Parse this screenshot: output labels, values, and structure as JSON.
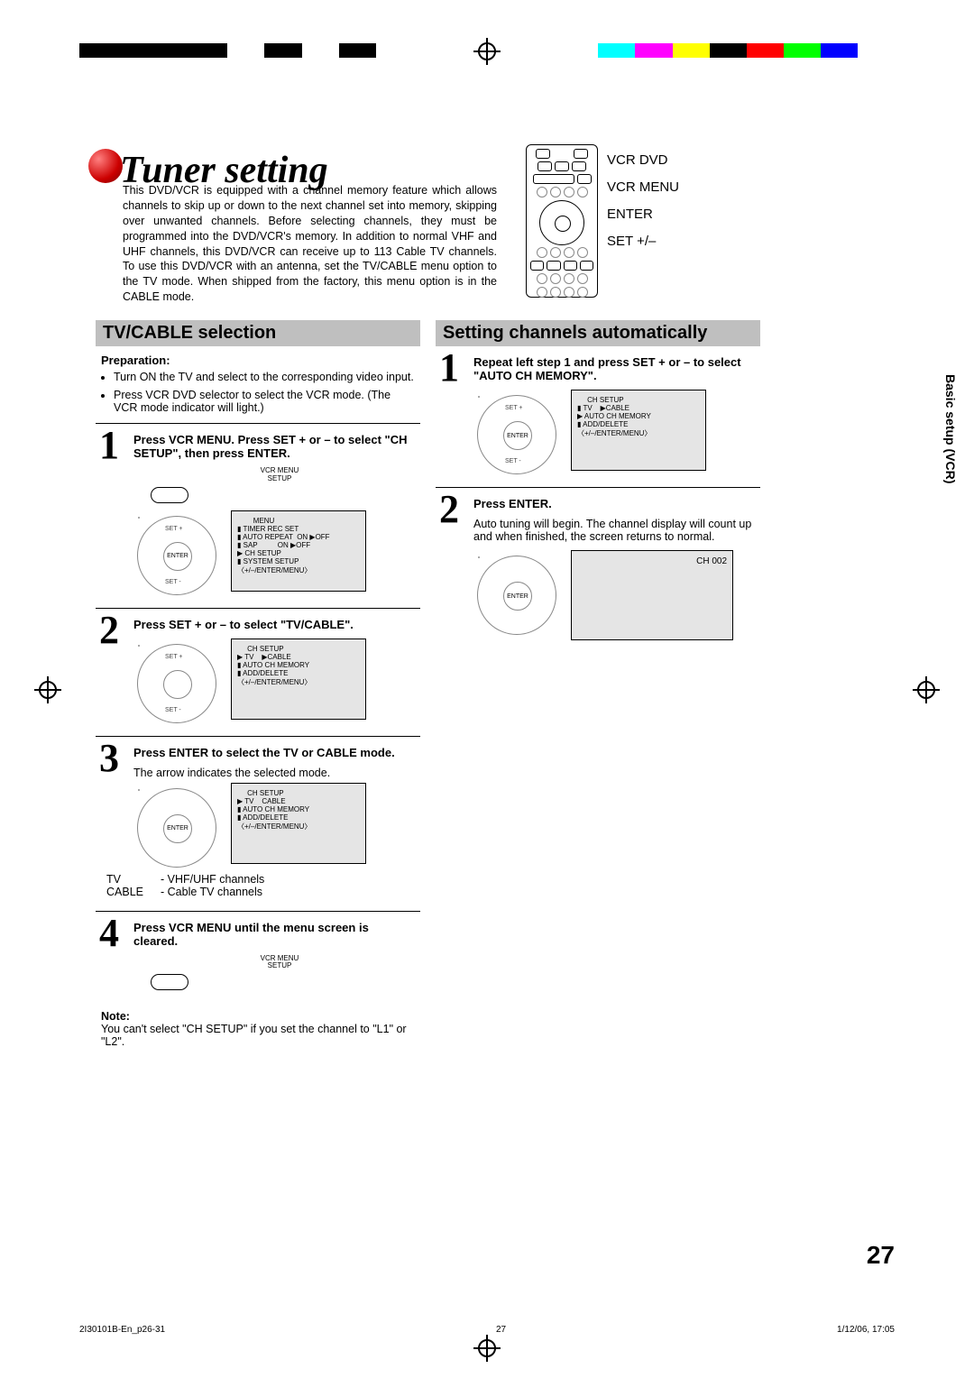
{
  "page_number": "27",
  "section_tab": "Basic setup (VCR)",
  "heading": "Tuner setting",
  "intro": "This DVD/VCR is equipped with a channel memory feature which allows channels to skip up or down to the next channel set into memory, skipping over unwanted channels. Before selecting channels, they must be programmed into the DVD/VCR's memory. In addition to normal VHF and UHF channels, this DVD/VCR can receive up to 113 Cable TV channels. To use this DVD/VCR with an antenna, set the TV/CABLE menu option to the TV mode. When shipped from the factory, this menu option is in the CABLE mode.",
  "remote_labels": [
    "VCR DVD",
    "VCR MENU",
    "ENTER",
    "SET +/–"
  ],
  "left": {
    "title": "TV/CABLE selection",
    "prep_title": "Preparation:",
    "prep_items": [
      "Turn ON the TV and select to the corresponding video input.",
      "Press VCR DVD selector to select the VCR mode. (The VCR mode indicator will light.)"
    ],
    "steps": [
      {
        "num": "1",
        "head": "Press VCR MENU. Press SET + or – to select \"CH SETUP\", then press ENTER.",
        "vcrmenu_label": "VCR MENU\nSETUP",
        "dpad": {
          "top": "SET +",
          "bottom": "SET -",
          "center": "ENTER"
        },
        "osd": [
          "        MENU",
          "▮ TIMER REC SET",
          "▮ AUTO REPEAT  ON ▶OFF",
          "▮ SAP          ON ▶OFF",
          "▶ CH SETUP",
          "▮ SYSTEM SETUP",
          "",
          "〈+/–/ENTER/MENU〉"
        ]
      },
      {
        "num": "2",
        "head": "Press SET + or – to select \"TV/CABLE\".",
        "dpad": {
          "top": "SET +",
          "bottom": "SET -",
          "center": ""
        },
        "osd": [
          "     CH SETUP",
          "▶ TV    ▶CABLE",
          "▮ AUTO CH MEMORY",
          "▮ ADD/DELETE",
          "",
          "",
          "〈+/–/ENTER/MENU〉"
        ]
      },
      {
        "num": "3",
        "head": "Press ENTER to select the TV or CABLE mode.",
        "body": "The arrow indicates the selected mode.",
        "dpad": {
          "top": "",
          "bottom": "",
          "center": "ENTER"
        },
        "osd": [
          "     CH SETUP",
          "▶ TV    CABLE",
          "▮ AUTO CH MEMORY",
          "▮ ADD/DELETE",
          "",
          "",
          "〈+/–/ENTER/MENU〉"
        ],
        "table": [
          [
            "TV",
            "- VHF/UHF channels"
          ],
          [
            "CABLE",
            "- Cable TV channels"
          ]
        ]
      },
      {
        "num": "4",
        "head": "Press VCR MENU until the menu screen is cleared.",
        "vcrmenu_label": "VCR MENU\nSETUP"
      }
    ],
    "note_title": "Note:",
    "note_body": "You can't select \"CH SETUP\" if you set the channel to \"L1\" or \"L2\"."
  },
  "right": {
    "title": "Setting channels automatically",
    "steps": [
      {
        "num": "1",
        "head": "Repeat left step 1 and press SET + or – to select \"AUTO CH MEMORY\".",
        "dpad": {
          "top": "SET +",
          "bottom": "SET -",
          "center": "ENTER"
        },
        "osd": [
          "     CH SETUP",
          "▮ TV    ▶CABLE",
          "▶ AUTO CH MEMORY",
          "▮ ADD/DELETE",
          "",
          "",
          "〈+/–/ENTER/MENU〉"
        ]
      },
      {
        "num": "2",
        "head": "Press ENTER.",
        "body": "Auto tuning will begin. The channel display will count up and when finished, the screen returns to normal.",
        "dpad": {
          "top": "",
          "bottom": "",
          "center": "ENTER"
        },
        "osd_big": "CH 002"
      }
    ]
  },
  "footer": {
    "left": "2I30101B-En_p26-31",
    "center": "27",
    "right": "1/12/06, 17:05"
  },
  "colorbar": [
    "#000",
    "#000",
    "#000",
    "#000",
    "#fff",
    "#000",
    "#fff",
    "#000",
    "#fff",
    "#fff",
    "#fff",
    "#fff",
    "#fff",
    "#fff",
    "#00ffff",
    "#ff00ff",
    "#ffff00",
    "#000",
    "#ff0000",
    "#00ff00",
    "#0000ff",
    "#fff"
  ]
}
